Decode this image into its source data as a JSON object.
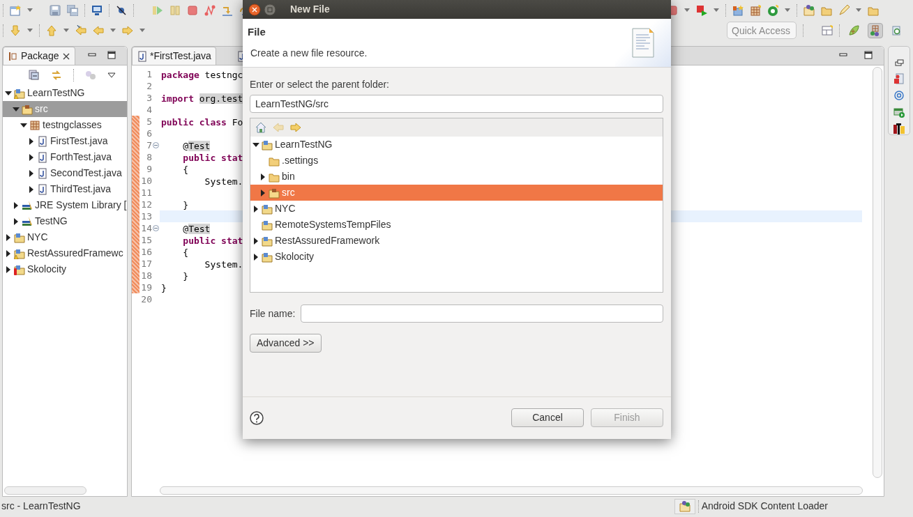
{
  "toolbar": {
    "perspectives": [
      {
        "selected": false
      },
      {
        "selected": true
      },
      {
        "selected": false
      }
    ],
    "quick_access": {
      "placeholder": "Quick Access"
    }
  },
  "package_view": {
    "tab": "Package",
    "tree": [
      {
        "label": "LearnTestNG",
        "kind": "project",
        "warning": true,
        "error": false,
        "expanded": true,
        "selected": false,
        "children": [
          {
            "label": "src",
            "kind": "source-folder",
            "expanded": true,
            "selected": true,
            "children": [
              {
                "label": "testngclasses",
                "kind": "package",
                "expanded": true,
                "selected": false,
                "children": [
                  {
                    "label": "FirstTest.java",
                    "kind": "java-file",
                    "expanded": false,
                    "selected": false
                  },
                  {
                    "label": "ForthTest.java",
                    "kind": "java-file",
                    "expanded": false,
                    "selected": false
                  },
                  {
                    "label": "SecondTest.java",
                    "kind": "java-file",
                    "expanded": false,
                    "selected": false
                  },
                  {
                    "label": "ThirdTest.java",
                    "kind": "java-file",
                    "expanded": false,
                    "selected": false
                  }
                ]
              }
            ]
          },
          {
            "label": "JRE System Library [",
            "kind": "library",
            "expanded": false,
            "selected": false
          },
          {
            "label": "TestNG",
            "kind": "library",
            "expanded": false,
            "selected": false
          }
        ]
      },
      {
        "label": "NYC",
        "kind": "project",
        "warning": false,
        "error": false,
        "expanded": false,
        "selected": false
      },
      {
        "label": "RestAssuredFramewc",
        "kind": "project",
        "warning": true,
        "error": false,
        "expanded": false,
        "selected": false
      },
      {
        "label": "Skolocity",
        "kind": "project",
        "warning": false,
        "error": true,
        "expanded": false,
        "selected": false
      }
    ]
  },
  "editor": {
    "tabs": [
      {
        "label": "*FirstTest.java",
        "selected": true
      },
      {
        "selected": false
      }
    ],
    "lines": [
      {
        "number": "1",
        "changed": false,
        "current": false,
        "tokens": [
          {
            "kind": "keyword",
            "text": "package"
          },
          {
            "kind": "plain",
            "text": " testngc"
          }
        ]
      },
      {
        "number": "2",
        "changed": false,
        "current": false
      },
      {
        "number": "3",
        "changed": false,
        "current": false,
        "tokens": [
          {
            "kind": "keyword",
            "text": "import "
          },
          {
            "kind": "marked",
            "text": "org.test"
          }
        ]
      },
      {
        "number": "4",
        "changed": false,
        "current": false
      },
      {
        "number": "5",
        "changed": true,
        "current": false,
        "tokens": [
          {
            "kind": "keyword",
            "text": "public class"
          },
          {
            "kind": "plain",
            "text": " Fo"
          }
        ]
      },
      {
        "number": "6",
        "changed": true,
        "current": false
      },
      {
        "number": "7",
        "changed": true,
        "current": false,
        "folded": false,
        "tokens": [
          {
            "kind": "plain",
            "text": "    @"
          },
          {
            "kind": "marked",
            "text": "Test"
          }
        ]
      },
      {
        "number": "8",
        "changed": true,
        "current": false,
        "tokens": [
          {
            "kind": "keyword",
            "text": "    public stat"
          }
        ]
      },
      {
        "number": "9",
        "changed": true,
        "current": false,
        "tokens": [
          {
            "kind": "plain",
            "text": "    {"
          }
        ]
      },
      {
        "number": "10",
        "changed": true,
        "current": false,
        "tokens": [
          {
            "kind": "plain",
            "text": "        System."
          }
        ]
      },
      {
        "number": "11",
        "changed": true,
        "current": false
      },
      {
        "number": "12",
        "changed": true,
        "current": false,
        "tokens": [
          {
            "kind": "plain",
            "text": "    }"
          }
        ]
      },
      {
        "number": "13",
        "changed": true,
        "current": true
      },
      {
        "number": "14",
        "changed": true,
        "current": false,
        "folded": false,
        "tokens": [
          {
            "kind": "plain",
            "text": "    @"
          },
          {
            "kind": "marked",
            "text": "Test"
          }
        ]
      },
      {
        "number": "15",
        "changed": true,
        "current": false,
        "tokens": [
          {
            "kind": "keyword",
            "text": "    public stat"
          }
        ]
      },
      {
        "number": "16",
        "changed": true,
        "current": false,
        "tokens": [
          {
            "kind": "plain",
            "text": "    {"
          }
        ]
      },
      {
        "number": "17",
        "changed": true,
        "current": false,
        "tokens": [
          {
            "kind": "plain",
            "text": "        System."
          }
        ]
      },
      {
        "number": "18",
        "changed": true,
        "current": false,
        "tokens": [
          {
            "kind": "plain",
            "text": "    }"
          }
        ]
      },
      {
        "number": "19",
        "changed": true,
        "current": false,
        "tokens": [
          {
            "kind": "plain",
            "text": "}"
          }
        ]
      },
      {
        "number": "20",
        "changed": false,
        "current": false
      }
    ]
  },
  "dialog": {
    "title": "New File",
    "heading": "File",
    "description": "Create a new file resource.",
    "folder_label": "Enter or select the parent folder:",
    "folder_value": "LearnTestNG/src",
    "tree_nav": [
      {
        "kind": "home",
        "disabled": false
      },
      {
        "kind": "back",
        "disabled": true
      },
      {
        "kind": "forward",
        "disabled": false
      }
    ],
    "tree": [
      {
        "label": "LearnTestNG",
        "kind": "project",
        "expanded": true,
        "selected": false,
        "children": [
          {
            "label": ".settings",
            "kind": "folder",
            "selected": false
          },
          {
            "label": "bin",
            "kind": "folder",
            "expanded": false,
            "selected": false
          },
          {
            "label": "src",
            "kind": "source-folder",
            "expanded": false,
            "selected": true
          }
        ]
      },
      {
        "label": "NYC",
        "kind": "project",
        "expanded": false,
        "selected": false
      },
      {
        "label": "RemoteSystemsTempFiles",
        "kind": "project",
        "selected": false
      },
      {
        "label": "RestAssuredFramework",
        "kind": "project",
        "expanded": false,
        "selected": false
      },
      {
        "label": "Skolocity",
        "kind": "project",
        "expanded": false,
        "selected": false
      }
    ],
    "file_name_label": "File name:",
    "advanced_button": "Advanced >>",
    "buttons": [
      {
        "label": "Cancel",
        "disabled": false
      },
      {
        "label": "Finish",
        "disabled": true
      }
    ]
  },
  "status_bar": {
    "selection": "src - LearnTestNG",
    "task": "Android SDK Content Loader"
  }
}
